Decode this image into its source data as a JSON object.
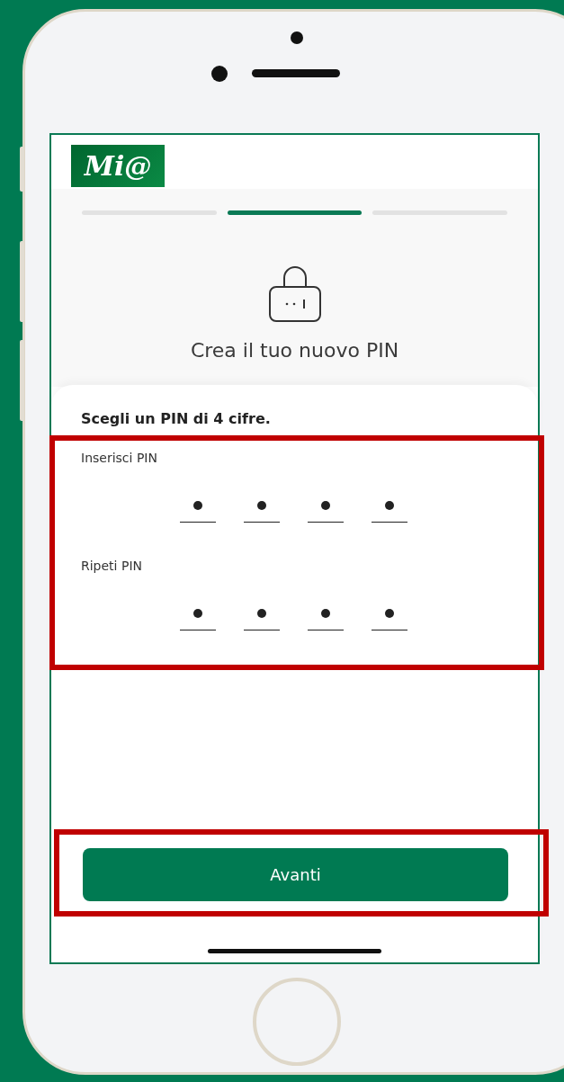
{
  "logo": {
    "text": "Mi@"
  },
  "progress": [
    {
      "selected": false
    },
    {
      "selected": true
    },
    {
      "selected": false
    }
  ],
  "title": "Crea il tuo nuovo PIN",
  "instruction": "Scegli un PIN di 4 cifre.",
  "pin_fields": [
    {
      "label": "Inserisci PIN",
      "digits": [
        {
          "filled": true
        },
        {
          "filled": true
        },
        {
          "filled": true
        },
        {
          "filled": true
        }
      ]
    },
    {
      "label": "Ripeti PIN",
      "digits": [
        {
          "filled": true
        },
        {
          "filled": true
        },
        {
          "filled": true
        },
        {
          "filled": true
        }
      ]
    }
  ],
  "button": "Avanti"
}
